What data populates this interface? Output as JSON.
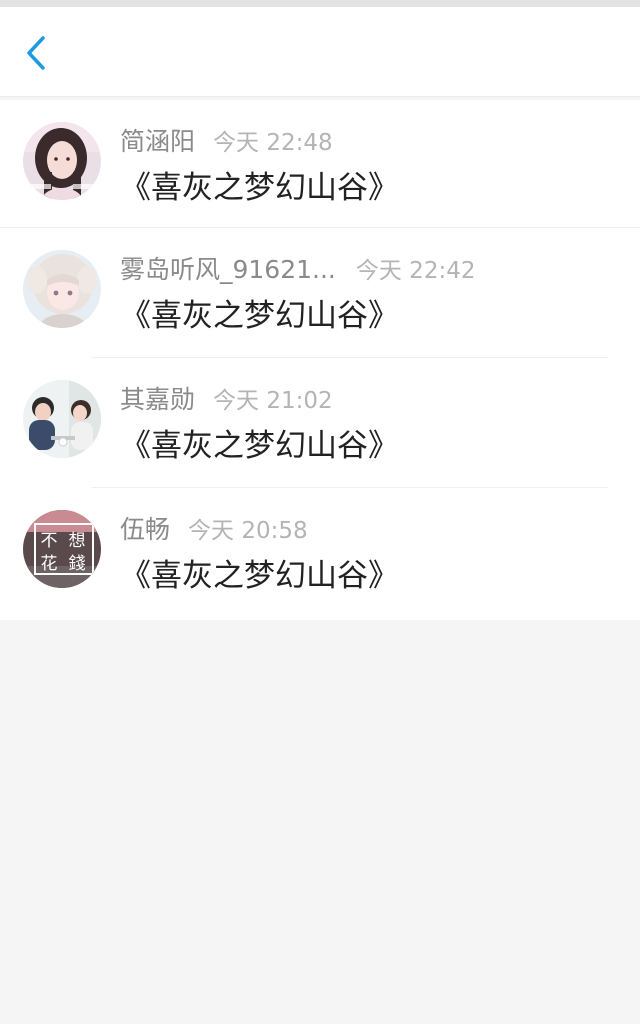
{
  "header": {
    "back_icon": "chevron-left-icon"
  },
  "colors": {
    "accent": "#1e9ae0",
    "background": "#f5f5f5",
    "card": "#ffffff",
    "name_text": "#8a8a8a",
    "time_text": "#b4b4b4",
    "title_text": "#222222"
  },
  "rows": [
    {
      "username": "简涵阳",
      "timestamp": "今天 22:48",
      "book": "《喜灰之梦幻山谷》",
      "avatar_icon": "user-avatar-girl"
    },
    {
      "username": "雾岛听风_91621...",
      "timestamp": "今天 22:42",
      "book": "《喜灰之梦幻山谷》",
      "avatar_icon": "user-avatar-anime-girl"
    },
    {
      "username": "其嘉勋",
      "timestamp": "今天 21:02",
      "book": "《喜灰之梦幻山谷》",
      "avatar_icon": "user-avatar-couple"
    },
    {
      "username": "伍畅",
      "timestamp": "今天 20:58",
      "book": "《喜灰之梦幻山谷》",
      "avatar_icon": "user-avatar-stamp",
      "avatar_text": [
        "不",
        "想",
        "花",
        "錢"
      ]
    }
  ]
}
